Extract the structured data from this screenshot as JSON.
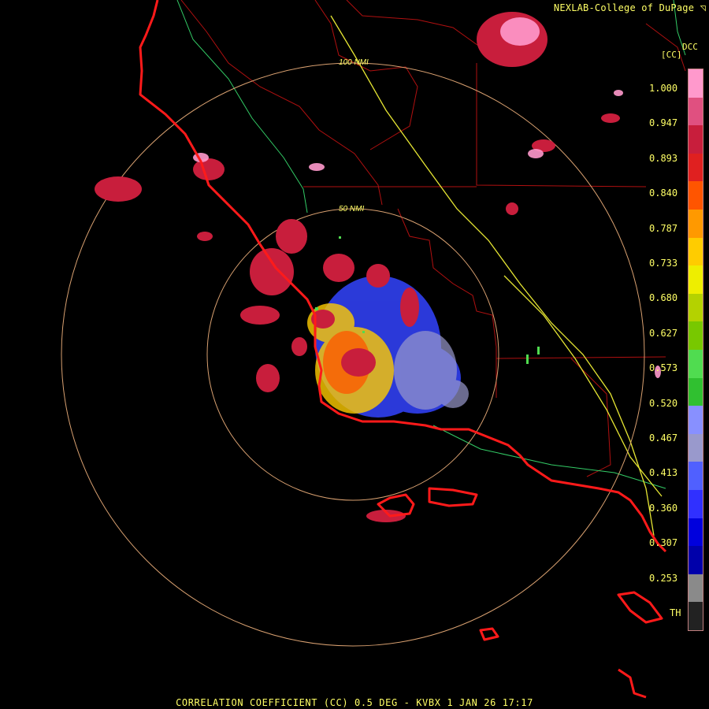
{
  "credit": "NEXLAB-College of DuPage",
  "credit_icon": "corner-logo-icon",
  "product_code": "DCC",
  "product_unit": "[CC]",
  "range_rings": [
    {
      "label": "50 NMI"
    },
    {
      "label": "100 NMI"
    }
  ],
  "colorbar": {
    "labels": [
      "1.000",
      "0.947",
      "0.893",
      "0.840",
      "0.787",
      "0.733",
      "0.680",
      "0.627",
      "0.573",
      "0.520",
      "0.467",
      "0.413",
      "0.360",
      "0.307",
      "0.253",
      "TH"
    ],
    "colors": [
      "#ff99cc",
      "#e05080",
      "#c81e3c",
      "#e02020",
      "#ff5500",
      "#ff9900",
      "#ffcc00",
      "#eeee00",
      "#b4d200",
      "#78c800",
      "#50dc50",
      "#30c030",
      "#8890ff",
      "#9999cc",
      "#5060ff",
      "#3030ff",
      "#0000dd",
      "#0000aa",
      "#8a8a8a",
      "#222222"
    ]
  },
  "footer": "CORRELATION COEFFICIENT (CC) 0.5 DEG - KVBX 1 JAN 26 17:17",
  "colors": {
    "coastline": "#ff1a1a",
    "county_lines": "#b01010",
    "range_rings": "#d8a070",
    "highway": "#e6e633",
    "state_roads": "#33cc66",
    "text": "#ffff66",
    "background": "#000000"
  }
}
